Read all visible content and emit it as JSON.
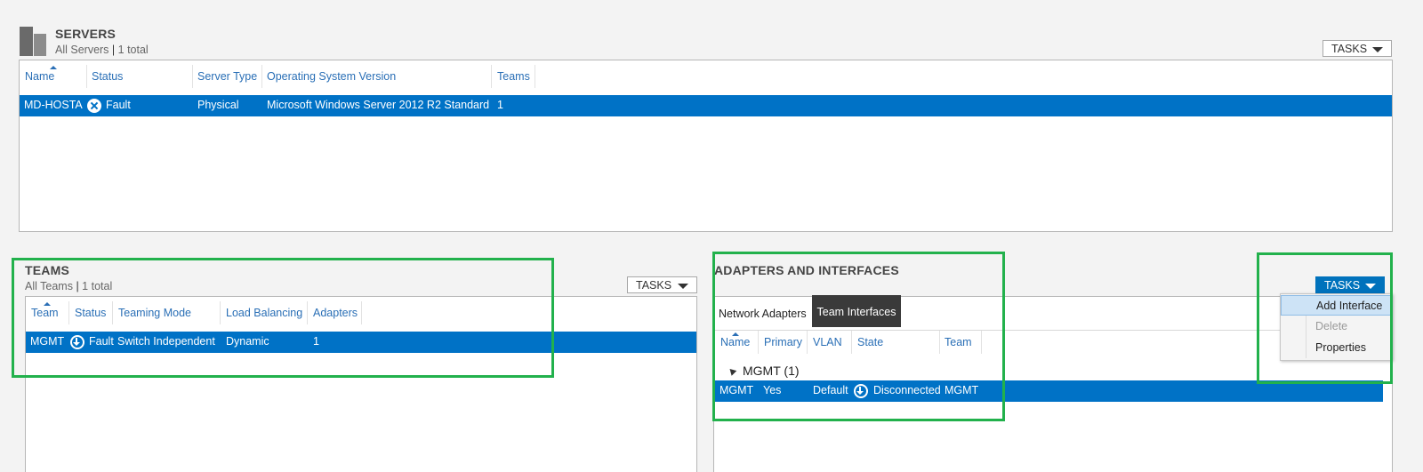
{
  "servers": {
    "title": "SERVERS",
    "subtitle_scope": "All Servers",
    "subtitle_count": "1 total",
    "tasks_label": "TASKS",
    "columns": [
      "Name",
      "Status",
      "Server Type",
      "Operating System Version",
      "Teams"
    ],
    "rows": [
      {
        "name": "MD-HOSTA",
        "status": "Fault",
        "server_type": "Physical",
        "os": "Microsoft Windows Server 2012 R2 Standard",
        "teams": "1"
      }
    ]
  },
  "teams": {
    "title": "TEAMS",
    "subtitle_scope": "All Teams",
    "subtitle_count": "1 total",
    "tasks_label": "TASKS",
    "columns": [
      "Team",
      "Status",
      "Teaming Mode",
      "Load Balancing",
      "Adapters"
    ],
    "rows": [
      {
        "team": "MGMT",
        "status": "Fault",
        "mode": "Switch Independent",
        "load_balancing": "Dynamic",
        "adapters": "1"
      }
    ]
  },
  "adapters": {
    "title": "ADAPTERS AND INTERFACES",
    "tasks_label": "TASKS",
    "tabs": [
      "Network Adapters",
      "Team Interfaces"
    ],
    "active_tab": "Team Interfaces",
    "columns": [
      "Name",
      "Primary",
      "VLAN",
      "State",
      "Team"
    ],
    "group_label": "MGMT (1)",
    "rows": [
      {
        "name": "MGMT",
        "primary": "Yes",
        "vlan": "Default",
        "state": "Disconnected",
        "team": "MGMT"
      }
    ]
  },
  "tasks_menu": {
    "items": [
      {
        "label": "Add Interface",
        "state": "highlighted"
      },
      {
        "label": "Delete",
        "state": "disabled"
      },
      {
        "label": "Properties",
        "state": "enabled"
      }
    ]
  },
  "colors": {
    "selection": "#0072c6",
    "header_text": "#2a6fb6",
    "highlight_box": "#22b14c",
    "active_tab": "#3a3a3a"
  }
}
